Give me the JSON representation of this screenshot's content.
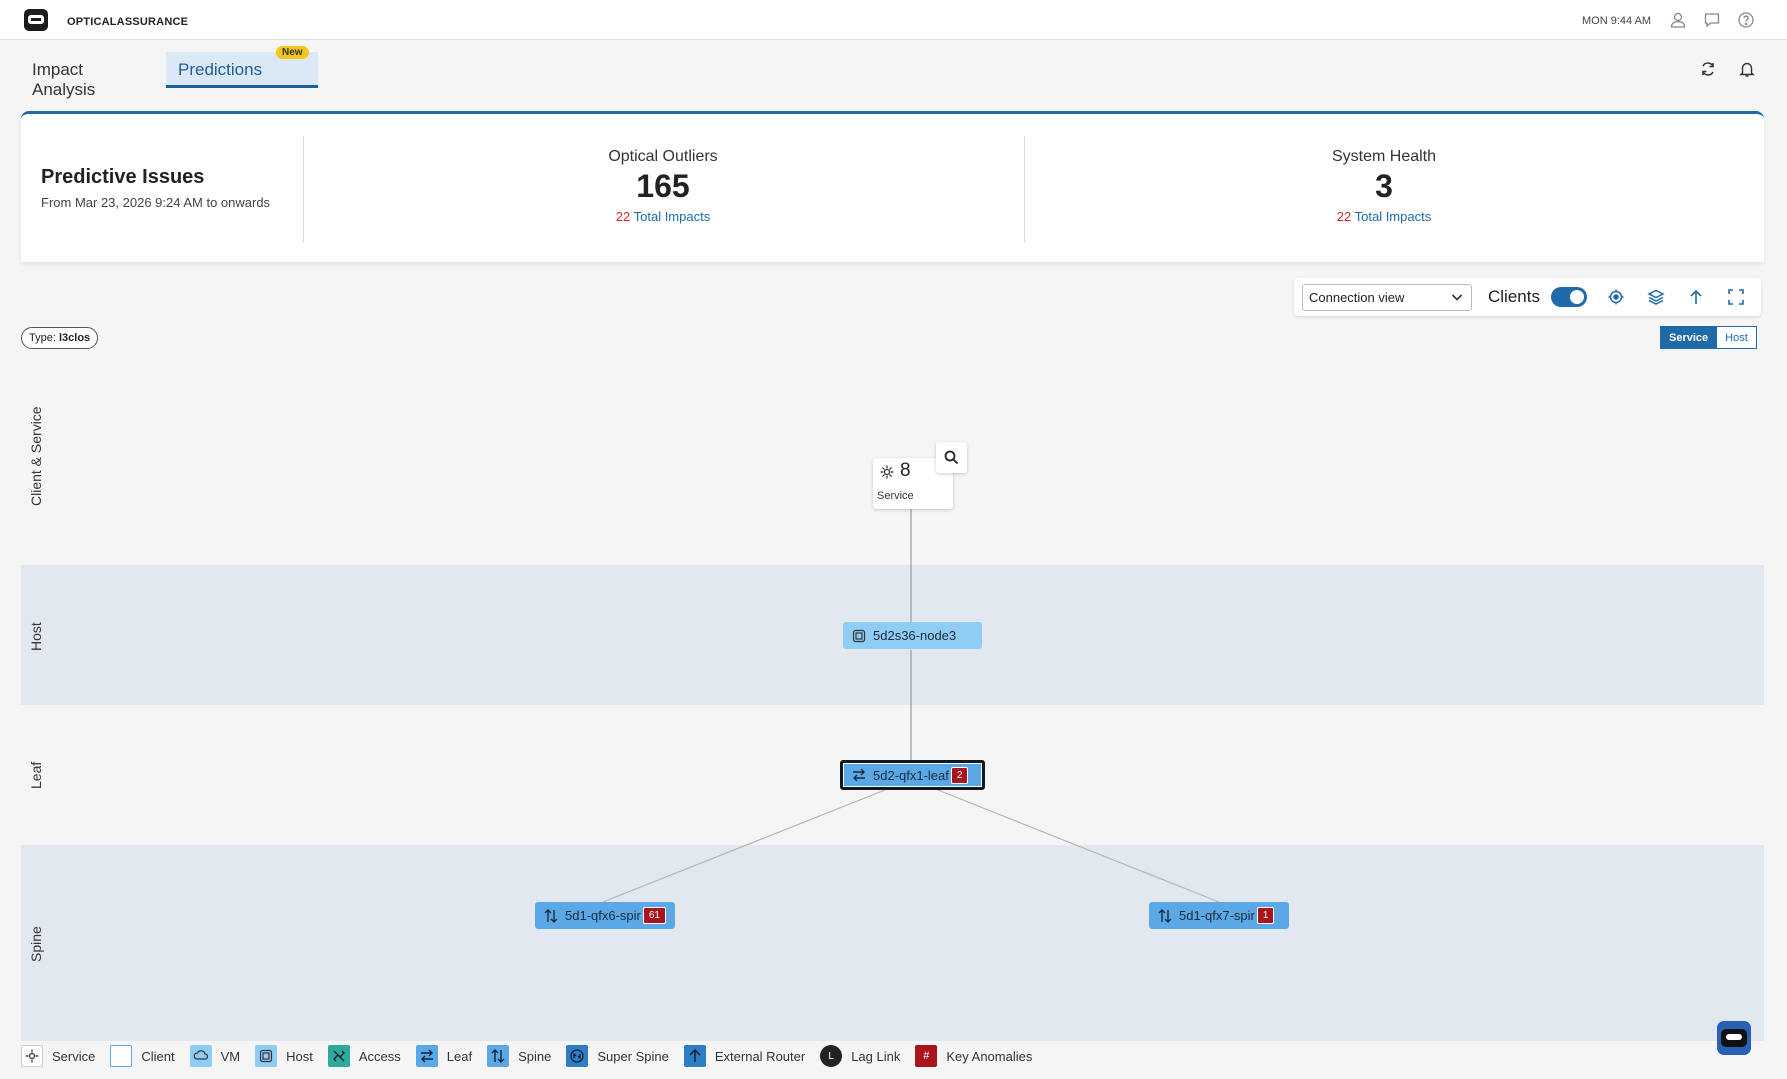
{
  "app": {
    "title": "OPTICALASSURANCE",
    "clock": "MON 9:44 AM"
  },
  "tabs": [
    {
      "label": "Impact Analysis",
      "active": false
    },
    {
      "label": "Predictions",
      "active": true,
      "badge": "New"
    }
  ],
  "summary": {
    "title": "Predictive Issues",
    "subtitle": "From Mar 23, 2026 9:24 AM to onwards",
    "metrics": [
      {
        "label": "Optical Outliers",
        "value": "165",
        "impact_count": "22",
        "impact_label": "Total Impacts"
      },
      {
        "label": "System Health",
        "value": "3",
        "impact_count": "22",
        "impact_label": "Total Impacts"
      }
    ]
  },
  "toolbar": {
    "view_select": "Connection view",
    "clients_label": "Clients",
    "clients_enabled": true
  },
  "filter": {
    "type_prefix": "Type:",
    "type_value": "l3clos"
  },
  "view_toggle": {
    "service": "Service",
    "host": "Host",
    "active": "Service"
  },
  "layers": [
    "Client & Service",
    "Host",
    "Leaf",
    "Spine"
  ],
  "topology": {
    "service": {
      "count": "8",
      "label": "Service"
    },
    "host": {
      "label": "5d2s36-node3"
    },
    "leaf": {
      "label": "5d2-qfx1-leaf",
      "badge": "2"
    },
    "spines": [
      {
        "label": "5d1-qfx6-spir",
        "badge": "61"
      },
      {
        "label": "5d1-qfx7-spir",
        "badge": "1"
      }
    ]
  },
  "legend": [
    "Service",
    "Client",
    "VM",
    "Host",
    "Access",
    "Leaf",
    "Spine",
    "Super Spine",
    "External Router",
    "Lag Link",
    "Key Anomalies"
  ],
  "colors": {
    "accent": "#1f6aa8",
    "anomaly": "#a8151d",
    "node": "#90cdf4",
    "node_dark": "#5aa9e6"
  }
}
